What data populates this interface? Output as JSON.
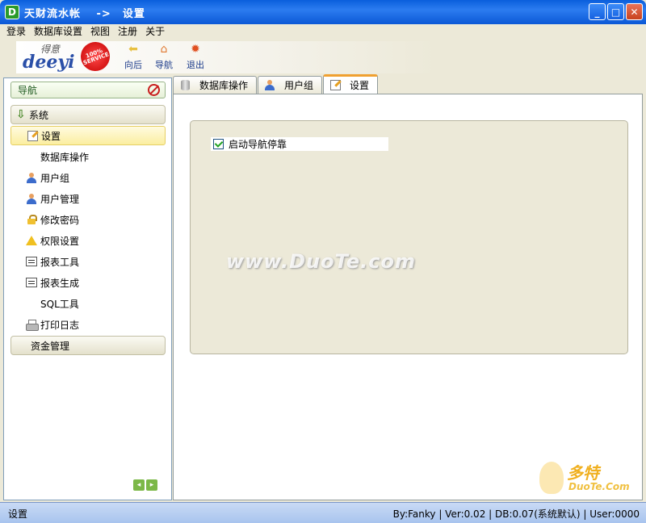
{
  "window": {
    "icon": "D",
    "title": "天财流水帐　 ->　设置",
    "buttons": [
      "minimize-icon",
      "maximize-icon",
      "close-icon"
    ]
  },
  "menu": [
    "登录",
    "数据库设置",
    "视图",
    "注册",
    "关于"
  ],
  "logo": {
    "text": "deeyi",
    "sub": "得意",
    "badge": "100% SERVICE"
  },
  "toolbar": [
    {
      "label": "向后",
      "icon": "back-arrow-icon",
      "color": "#e8c040"
    },
    {
      "label": "导航",
      "icon": "home-icon",
      "color": "#e07830"
    },
    {
      "label": "退出",
      "icon": "exit-icon",
      "color": "#e05020"
    }
  ],
  "nav": {
    "header": "导航",
    "group_system": "系统",
    "items": [
      {
        "label": "设置",
        "icon": "settings-edit-icon",
        "selected": true
      },
      {
        "label": "数据库操作",
        "icon": ""
      },
      {
        "label": "用户组",
        "icon": "user-icon"
      },
      {
        "label": "用户管理",
        "icon": "user-icon"
      },
      {
        "label": "修改密码",
        "icon": "lock-icon"
      },
      {
        "label": "权限设置",
        "icon": "warning-icon"
      },
      {
        "label": "报表工具",
        "icon": "report-icon"
      },
      {
        "label": "报表生成",
        "icon": "report-icon"
      },
      {
        "label": "SQL工具",
        "icon": ""
      },
      {
        "label": "打印日志",
        "icon": "printer-icon"
      }
    ],
    "group_finance": "资金管理"
  },
  "tabs": [
    {
      "label": "数据库操作",
      "icon": "database-icon",
      "active": false
    },
    {
      "label": "用户组",
      "icon": "user-icon",
      "active": false
    },
    {
      "label": "设置",
      "icon": "settings-edit-icon",
      "active": true
    }
  ],
  "settings": {
    "dock_nav_label": "启动导航停靠",
    "dock_nav_checked": true
  },
  "watermark": "www.DuoTe.com",
  "corner_watermark": {
    "big": "多特",
    "small": "DuoTe.Com"
  },
  "status": {
    "left": "设置",
    "right": "By:Fanky | Ver:0.02 | DB:0.07(系统默认) | User:0000"
  },
  "colors": {
    "titlebar": "#0a5fdc",
    "selected_item": "#fbeea0",
    "active_tab_accent": "#f0a030",
    "statusbar": "#a8c4ee"
  }
}
